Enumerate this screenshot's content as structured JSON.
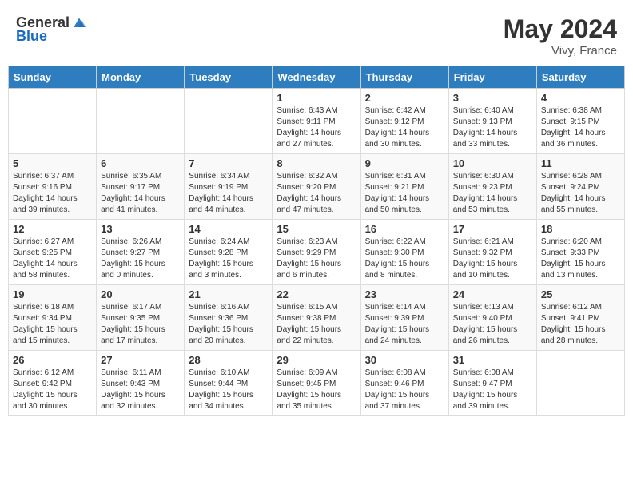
{
  "header": {
    "logo_general": "General",
    "logo_blue": "Blue",
    "month_year": "May 2024",
    "location": "Vivy, France"
  },
  "days_of_week": [
    "Sunday",
    "Monday",
    "Tuesday",
    "Wednesday",
    "Thursday",
    "Friday",
    "Saturday"
  ],
  "weeks": [
    [
      {
        "day": "",
        "info": ""
      },
      {
        "day": "",
        "info": ""
      },
      {
        "day": "",
        "info": ""
      },
      {
        "day": "1",
        "info": "Sunrise: 6:43 AM\nSunset: 9:11 PM\nDaylight: 14 hours and 27 minutes."
      },
      {
        "day": "2",
        "info": "Sunrise: 6:42 AM\nSunset: 9:12 PM\nDaylight: 14 hours and 30 minutes."
      },
      {
        "day": "3",
        "info": "Sunrise: 6:40 AM\nSunset: 9:13 PM\nDaylight: 14 hours and 33 minutes."
      },
      {
        "day": "4",
        "info": "Sunrise: 6:38 AM\nSunset: 9:15 PM\nDaylight: 14 hours and 36 minutes."
      }
    ],
    [
      {
        "day": "5",
        "info": "Sunrise: 6:37 AM\nSunset: 9:16 PM\nDaylight: 14 hours and 39 minutes."
      },
      {
        "day": "6",
        "info": "Sunrise: 6:35 AM\nSunset: 9:17 PM\nDaylight: 14 hours and 41 minutes."
      },
      {
        "day": "7",
        "info": "Sunrise: 6:34 AM\nSunset: 9:19 PM\nDaylight: 14 hours and 44 minutes."
      },
      {
        "day": "8",
        "info": "Sunrise: 6:32 AM\nSunset: 9:20 PM\nDaylight: 14 hours and 47 minutes."
      },
      {
        "day": "9",
        "info": "Sunrise: 6:31 AM\nSunset: 9:21 PM\nDaylight: 14 hours and 50 minutes."
      },
      {
        "day": "10",
        "info": "Sunrise: 6:30 AM\nSunset: 9:23 PM\nDaylight: 14 hours and 53 minutes."
      },
      {
        "day": "11",
        "info": "Sunrise: 6:28 AM\nSunset: 9:24 PM\nDaylight: 14 hours and 55 minutes."
      }
    ],
    [
      {
        "day": "12",
        "info": "Sunrise: 6:27 AM\nSunset: 9:25 PM\nDaylight: 14 hours and 58 minutes."
      },
      {
        "day": "13",
        "info": "Sunrise: 6:26 AM\nSunset: 9:27 PM\nDaylight: 15 hours and 0 minutes."
      },
      {
        "day": "14",
        "info": "Sunrise: 6:24 AM\nSunset: 9:28 PM\nDaylight: 15 hours and 3 minutes."
      },
      {
        "day": "15",
        "info": "Sunrise: 6:23 AM\nSunset: 9:29 PM\nDaylight: 15 hours and 6 minutes."
      },
      {
        "day": "16",
        "info": "Sunrise: 6:22 AM\nSunset: 9:30 PM\nDaylight: 15 hours and 8 minutes."
      },
      {
        "day": "17",
        "info": "Sunrise: 6:21 AM\nSunset: 9:32 PM\nDaylight: 15 hours and 10 minutes."
      },
      {
        "day": "18",
        "info": "Sunrise: 6:20 AM\nSunset: 9:33 PM\nDaylight: 15 hours and 13 minutes."
      }
    ],
    [
      {
        "day": "19",
        "info": "Sunrise: 6:18 AM\nSunset: 9:34 PM\nDaylight: 15 hours and 15 minutes."
      },
      {
        "day": "20",
        "info": "Sunrise: 6:17 AM\nSunset: 9:35 PM\nDaylight: 15 hours and 17 minutes."
      },
      {
        "day": "21",
        "info": "Sunrise: 6:16 AM\nSunset: 9:36 PM\nDaylight: 15 hours and 20 minutes."
      },
      {
        "day": "22",
        "info": "Sunrise: 6:15 AM\nSunset: 9:38 PM\nDaylight: 15 hours and 22 minutes."
      },
      {
        "day": "23",
        "info": "Sunrise: 6:14 AM\nSunset: 9:39 PM\nDaylight: 15 hours and 24 minutes."
      },
      {
        "day": "24",
        "info": "Sunrise: 6:13 AM\nSunset: 9:40 PM\nDaylight: 15 hours and 26 minutes."
      },
      {
        "day": "25",
        "info": "Sunrise: 6:12 AM\nSunset: 9:41 PM\nDaylight: 15 hours and 28 minutes."
      }
    ],
    [
      {
        "day": "26",
        "info": "Sunrise: 6:12 AM\nSunset: 9:42 PM\nDaylight: 15 hours and 30 minutes."
      },
      {
        "day": "27",
        "info": "Sunrise: 6:11 AM\nSunset: 9:43 PM\nDaylight: 15 hours and 32 minutes."
      },
      {
        "day": "28",
        "info": "Sunrise: 6:10 AM\nSunset: 9:44 PM\nDaylight: 15 hours and 34 minutes."
      },
      {
        "day": "29",
        "info": "Sunrise: 6:09 AM\nSunset: 9:45 PM\nDaylight: 15 hours and 35 minutes."
      },
      {
        "day": "30",
        "info": "Sunrise: 6:08 AM\nSunset: 9:46 PM\nDaylight: 15 hours and 37 minutes."
      },
      {
        "day": "31",
        "info": "Sunrise: 6:08 AM\nSunset: 9:47 PM\nDaylight: 15 hours and 39 minutes."
      },
      {
        "day": "",
        "info": ""
      }
    ]
  ]
}
